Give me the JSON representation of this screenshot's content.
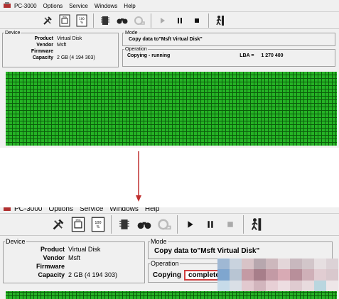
{
  "app": {
    "menu": [
      "PC-3000",
      "Options",
      "Service",
      "Windows",
      "Help"
    ]
  },
  "toolbar_icons": [
    "tools-icon",
    "disk-image-icon",
    "percent-tag-icon",
    "chip-icon",
    "binoculars-icon",
    "tape-roll-icon",
    "play-icon",
    "pause-icon",
    "stop-icon",
    "run-exit-icon"
  ],
  "device": {
    "legend": "Device",
    "rows": [
      {
        "key": "Product",
        "value": "Virtual Disk"
      },
      {
        "key": "Vendor",
        "value": "Msft"
      },
      {
        "key": "Firmware",
        "value": ""
      },
      {
        "key": "Capacity",
        "value": "2 GB (4 194 303)"
      }
    ]
  },
  "mode": {
    "legend": "Mode",
    "text": "Copy data to\"Msft Virtual Disk\""
  },
  "operation": {
    "legend": "Operation",
    "top_status": "Copying - running",
    "lba_label": "LBA =",
    "lba_value": "1 270 400",
    "bottom_label": "Copying",
    "bottom_status": "complete"
  },
  "colors": {
    "sector_green": "#25b425",
    "arrow_red": "#c03030",
    "highlight_red": "#d04040"
  }
}
